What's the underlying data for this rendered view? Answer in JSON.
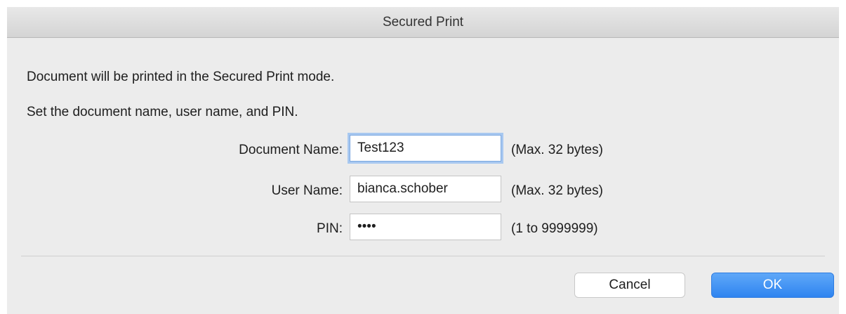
{
  "dialog": {
    "title": "Secured Print",
    "message_line1": "Document will be printed in the Secured Print mode.",
    "message_line2": "Set the document name, user name, and PIN."
  },
  "fields": {
    "document_name": {
      "label": "Document Name:",
      "value": "Test123",
      "hint": "(Max. 32 bytes)",
      "focused": true
    },
    "user_name": {
      "label": "User Name:",
      "value": "bianca.schober",
      "hint": "(Max. 32 bytes)"
    },
    "pin": {
      "label": "PIN:",
      "value": "••••",
      "hint": "(1 to 9999999)"
    }
  },
  "buttons": {
    "cancel_label": "Cancel",
    "ok_label": "OK"
  },
  "colors": {
    "accent": "#2f84f0",
    "focus_ring": "#a8c8f0"
  }
}
